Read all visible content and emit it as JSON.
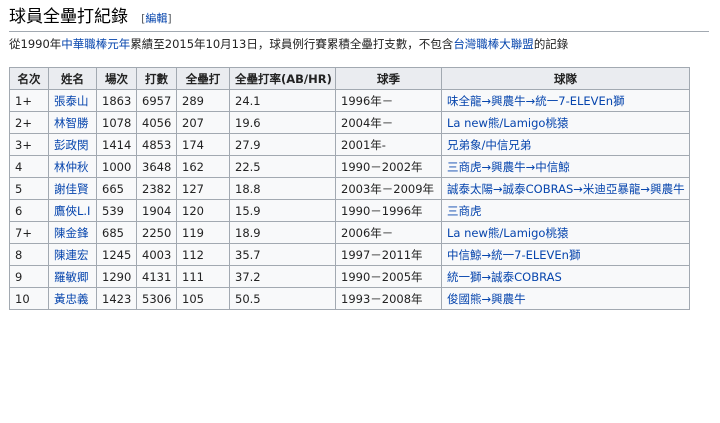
{
  "section": {
    "title": "球員全壘打紀錄",
    "edit_open": "[",
    "edit_label": "編輯",
    "edit_close": "]"
  },
  "intro": {
    "part1": "從1990年",
    "link1": "中華職棒元年",
    "part2": "累績至2015年10月13日，球員例行賽累積全壘打支數，不包含",
    "link2": "台灣職棒大聯盟",
    "part3": "的記錄"
  },
  "table": {
    "headers": [
      "名次",
      "姓名",
      "場次",
      "打數",
      "全壘打",
      "全壘打率(AB/HR)",
      "球季",
      "球隊"
    ],
    "rows": [
      {
        "rank": "1+",
        "name": "張泰山",
        "games": "1863",
        "ab": "6957",
        "hr": "289",
        "rate": "24.1",
        "season": "1996年－",
        "team": "味全龍→興農牛→統一7-ELEVEn獅"
      },
      {
        "rank": "2+",
        "name": "林智勝",
        "games": "1078",
        "ab": "4056",
        "hr": "207",
        "rate": "19.6",
        "season": "2004年－",
        "team": "La new熊/Lamigo桃猿"
      },
      {
        "rank": "3+",
        "name": "彭政閔",
        "games": "1414",
        "ab": "4853",
        "hr": "174",
        "rate": "27.9",
        "season": "2001年-",
        "team": "兄弟象/中信兄弟"
      },
      {
        "rank": "4",
        "name": "林仲秋",
        "games": "1000",
        "ab": "3648",
        "hr": "162",
        "rate": "22.5",
        "season": "1990－2002年",
        "team": "三商虎→興農牛→中信鯨"
      },
      {
        "rank": "5",
        "name": "謝佳賢",
        "games": "665",
        "ab": "2382",
        "hr": "127",
        "rate": "18.8",
        "season": "2003年－2009年",
        "team": "誠泰太陽→誠泰COBRAS→米迪亞暴龍→興農牛"
      },
      {
        "rank": "6",
        "name": "鷹俠L.I",
        "games": "539",
        "ab": "1904",
        "hr": "120",
        "rate": "15.9",
        "season": "1990－1996年",
        "team": "三商虎"
      },
      {
        "rank": "7+",
        "name": "陳金鋒",
        "games": "685",
        "ab": "2250",
        "hr": "119",
        "rate": "18.9",
        "season": "2006年－",
        "team": "La new熊/Lamigo桃猿"
      },
      {
        "rank": "8",
        "name": "陳連宏",
        "games": "1245",
        "ab": "4003",
        "hr": "112",
        "rate": "35.7",
        "season": "1997－2011年",
        "team": "中信鯨→統一7-ELEVEn獅"
      },
      {
        "rank": "9",
        "name": "羅敏卿",
        "games": "1290",
        "ab": "4131",
        "hr": "111",
        "rate": "37.2",
        "season": "1990－2005年",
        "team": "統一獅→誠泰COBRAS"
      },
      {
        "rank": "10",
        "name": "黃忠義",
        "games": "1423",
        "ab": "5306",
        "hr": "105",
        "rate": "50.5",
        "season": "1993－2008年",
        "team": "俊國熊→興農牛"
      }
    ]
  },
  "highlight": {
    "row": 2,
    "column": "hr",
    "color": "#e03030"
  },
  "colors": {
    "link": "#0645ad",
    "header_bg": "#eaecf0",
    "cell_bg": "#f8f9fa",
    "border": "#a2a9b1"
  }
}
